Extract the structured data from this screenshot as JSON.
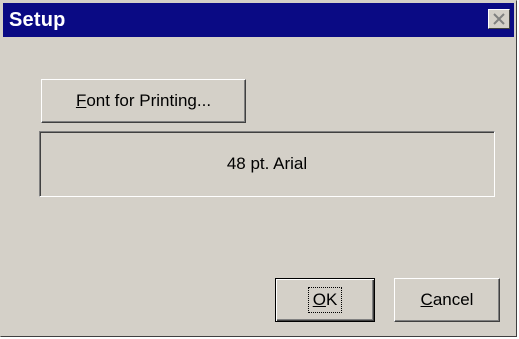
{
  "window": {
    "title": "Setup"
  },
  "buttons": {
    "font_for_printing": {
      "mnemonic": "F",
      "rest": "ont for Printing..."
    },
    "ok": {
      "mnemonic": "O",
      "rest": "K"
    },
    "cancel": {
      "mnemonic": "C",
      "rest": "ancel"
    }
  },
  "font_display": {
    "value": "48 pt. Arial"
  },
  "icons": {
    "close": "close-icon"
  },
  "colors": {
    "titlebar": "#0a0a84",
    "face": "#d4d0c8"
  }
}
